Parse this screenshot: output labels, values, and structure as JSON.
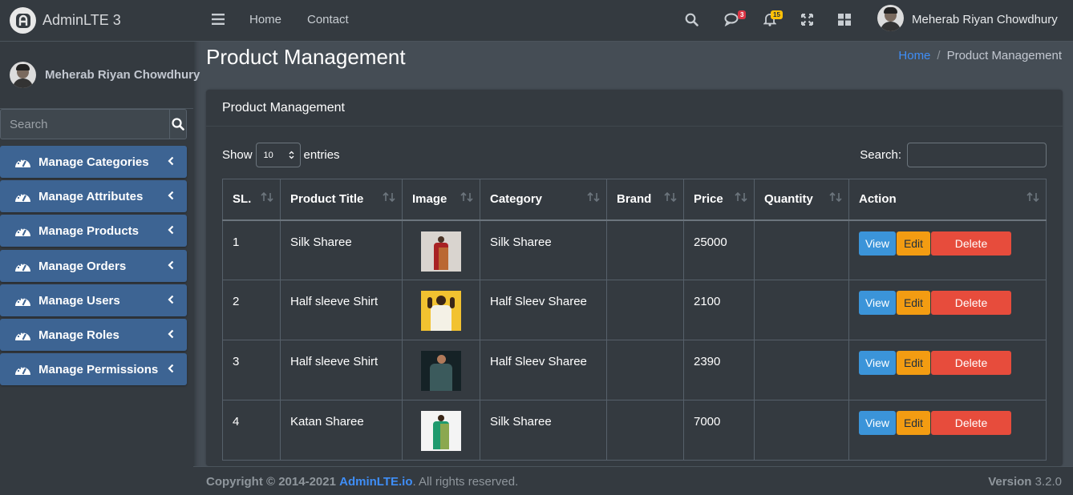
{
  "brand": {
    "name": "AdminLTE 3"
  },
  "user": {
    "name": "Meherab Riyan Chowdhury"
  },
  "sidebar": {
    "search_placeholder": "Search",
    "items": [
      {
        "label": "Manage Categories"
      },
      {
        "label": "Manage Attributes"
      },
      {
        "label": "Manage Products"
      },
      {
        "label": "Manage Orders"
      },
      {
        "label": "Manage Users"
      },
      {
        "label": "Manage Roles"
      },
      {
        "label": "Manage Permissions"
      }
    ]
  },
  "navbar": {
    "home": "Home",
    "contact": "Contact",
    "messages_count": "3",
    "notifications_count": "15",
    "user_name": "Meherab Riyan Chowdhury"
  },
  "page": {
    "title": "Product Management",
    "breadcrumb_home": "Home",
    "breadcrumb_current": "Product Management",
    "card_title": "Product Management"
  },
  "table_controls": {
    "show": "Show",
    "length": "10",
    "entries": "entries",
    "search": "Search:"
  },
  "table": {
    "headers": [
      "SL.",
      "Product Title",
      "Image",
      "Category",
      "Brand",
      "Price",
      "Quantity",
      "Action"
    ],
    "rows": [
      {
        "sl": "1",
        "title": "Silk Sharee",
        "category": "Silk Sharee",
        "brand": "",
        "price": "25000",
        "quantity": ""
      },
      {
        "sl": "2",
        "title": "Half sleeve Shirt",
        "category": "Half Sleev Sharee",
        "brand": "",
        "price": "2100",
        "quantity": ""
      },
      {
        "sl": "3",
        "title": "Half sleeve Shirt",
        "category": "Half Sleev Sharee",
        "brand": "",
        "price": "2390",
        "quantity": ""
      },
      {
        "sl": "4",
        "title": "Katan Sharee",
        "category": "Silk Sharee",
        "brand": "",
        "price": "7000",
        "quantity": ""
      }
    ],
    "actions": {
      "view": "View",
      "edit": "Edit",
      "delete": "Delete"
    }
  },
  "footer": {
    "copyright": "Copyright © 2014-2021",
    "link": "AdminLTE.io",
    "rights": ". All rights reserved.",
    "version_label": "Version",
    "version": "3.2.0"
  },
  "colors": {
    "sidebar_item": "#3d6493",
    "accent_link": "#3f8ef7",
    "view": "#3b94d9",
    "edit": "#f39c12",
    "delete": "#e74c3c"
  }
}
